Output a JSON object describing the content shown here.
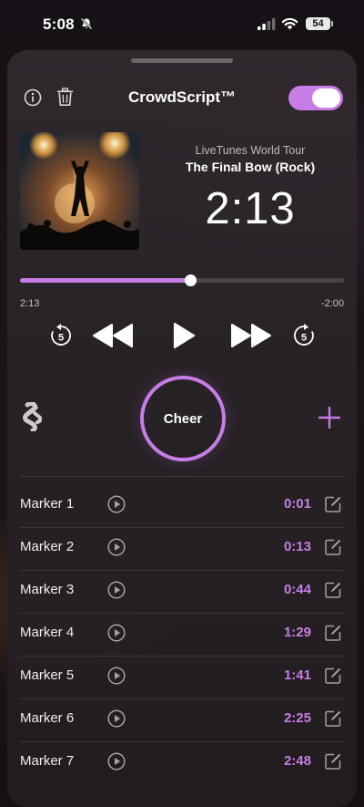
{
  "status": {
    "time": "5:08",
    "battery": "54"
  },
  "header": {
    "title": "CrowdScript™",
    "toggle_on": true
  },
  "now_playing": {
    "tour": "LiveTunes World Tour",
    "song": "The Final Bow (Rock)",
    "big_time": "2:13",
    "elapsed": "2:13",
    "remaining": "-2:00",
    "progress_percent": 52.5
  },
  "controls": {
    "skip_back_seconds": "5",
    "skip_forward_seconds": "5",
    "cheer_label": "Cheer"
  },
  "markers": [
    {
      "name": "Marker 1",
      "time": "0:01"
    },
    {
      "name": "Marker 2",
      "time": "0:13"
    },
    {
      "name": "Marker 3",
      "time": "0:44"
    },
    {
      "name": "Marker 4",
      "time": "1:29"
    },
    {
      "name": "Marker 5",
      "time": "1:41"
    },
    {
      "name": "Marker 6",
      "time": "2:25"
    },
    {
      "name": "Marker 7",
      "time": "2:48"
    }
  ],
  "colors": {
    "accent": "#c87de6",
    "background": "#141014",
    "sheet": "#2e2a2d"
  },
  "icons": {
    "info": "info-icon",
    "trash": "trash-icon",
    "skip_back": "skip-back-5-icon",
    "rewind": "rewind-icon",
    "play": "play-icon",
    "fast_forward": "fast-forward-icon",
    "skip_forward": "skip-forward-5-icon",
    "script": "script-icon",
    "add": "plus-icon",
    "marker_play": "play-circle-icon",
    "edit": "edit-icon"
  }
}
